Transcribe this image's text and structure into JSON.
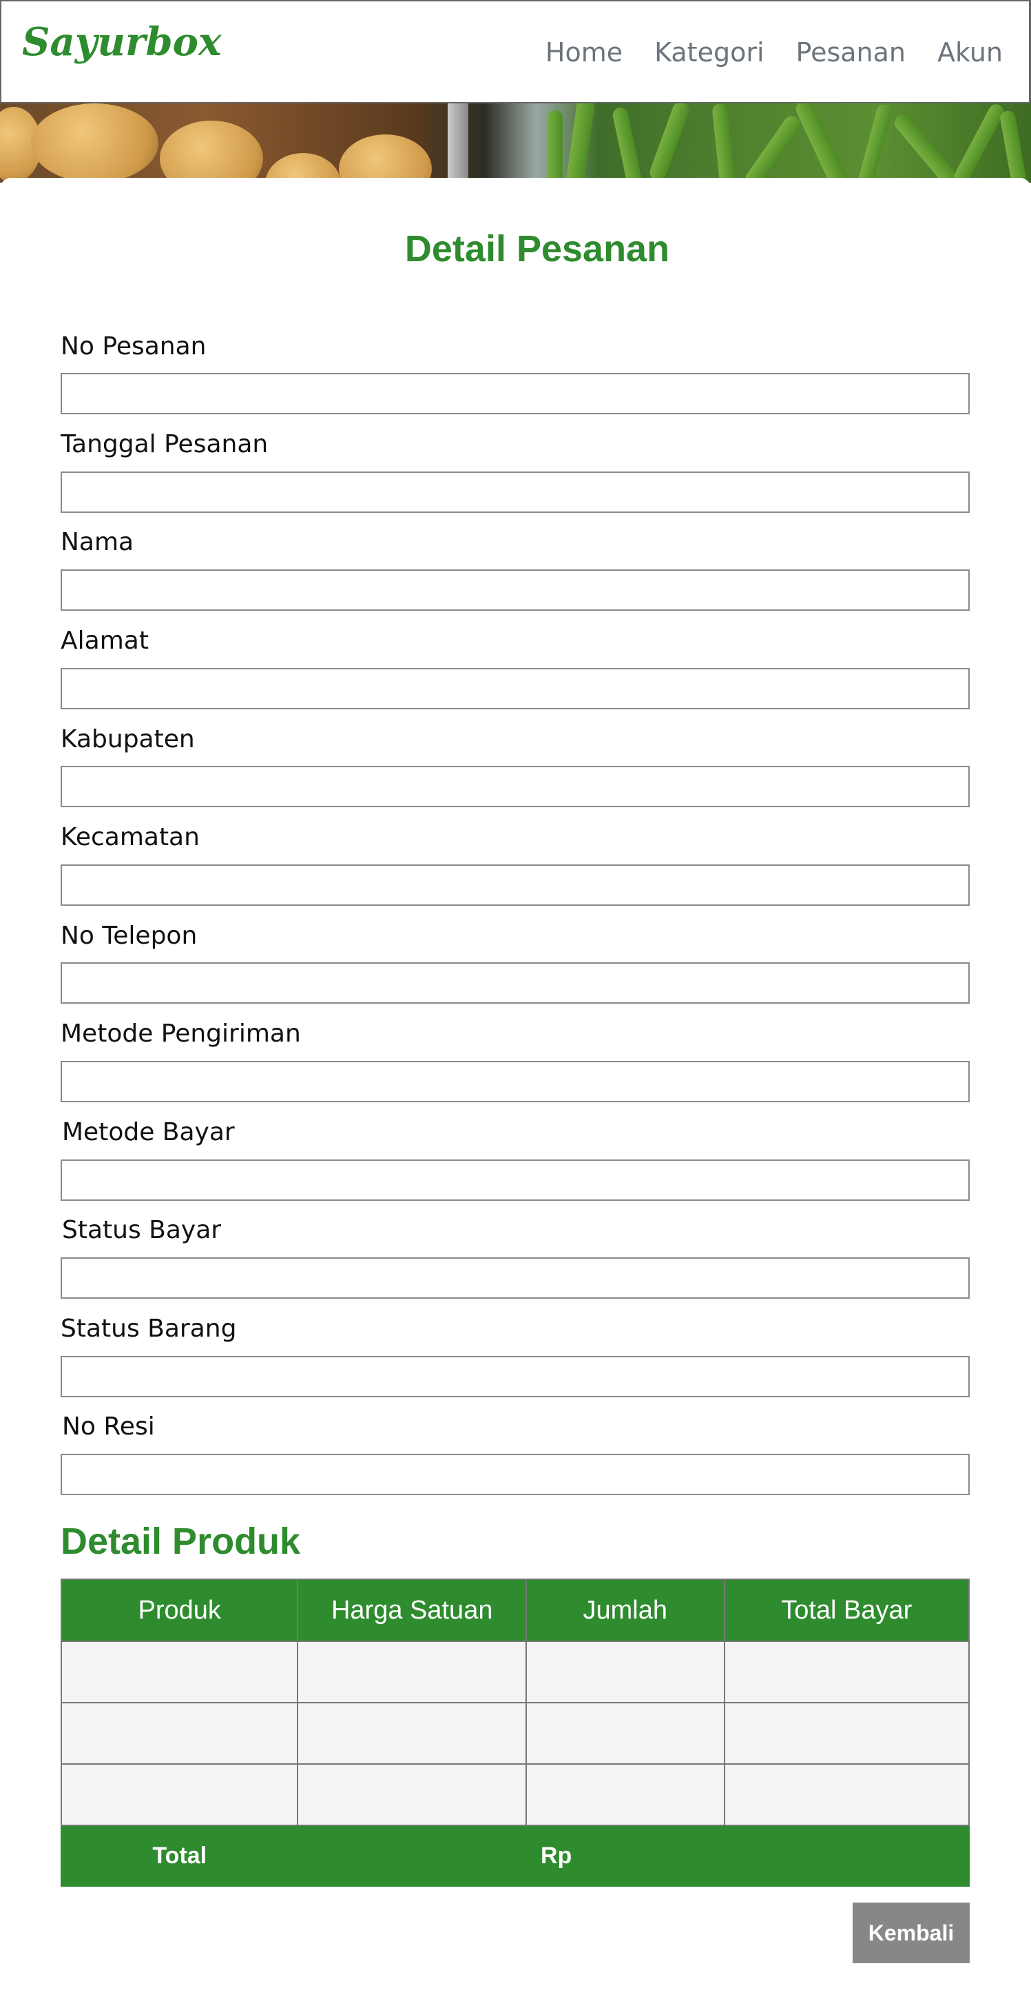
{
  "navbar": {
    "brand": "Sayurbox",
    "links": [
      "Home",
      "Kategori",
      "Pesanan",
      "Akun"
    ]
  },
  "page": {
    "title": "Detail Pesanan"
  },
  "form": {
    "fields": [
      {
        "label": "No Pesanan",
        "value": ""
      },
      {
        "label": "Tanggal Pesanan",
        "value": ""
      },
      {
        "label": "Nama",
        "value": ""
      },
      {
        "label": "Alamat",
        "value": ""
      },
      {
        "label": "Kabupaten",
        "value": ""
      },
      {
        "label": "Kecamatan",
        "value": ""
      },
      {
        "label": "No Telepon",
        "value": ""
      },
      {
        "label": "Metode Pengiriman",
        "value": ""
      },
      {
        "label": "Metode Bayar",
        "value": ""
      },
      {
        "label": "Status Bayar",
        "value": ""
      },
      {
        "label": "Status Barang",
        "value": ""
      },
      {
        "label": "No Resi",
        "value": ""
      }
    ]
  },
  "products": {
    "title": "Detail Produk",
    "columns": [
      "Produk",
      "Harga Satuan",
      "Jumlah",
      "Total Bayar"
    ],
    "rows": [
      [
        "",
        "",
        "",
        ""
      ],
      [
        "",
        "",
        "",
        ""
      ],
      [
        "",
        "",
        "",
        ""
      ]
    ],
    "footer": {
      "total_label": "Total",
      "currency_label": "Rp"
    }
  },
  "actions": {
    "back_label": "Kembali"
  },
  "colors": {
    "brand": "#2e8b2e",
    "nav_text": "#6c757d",
    "button": "#878787"
  }
}
